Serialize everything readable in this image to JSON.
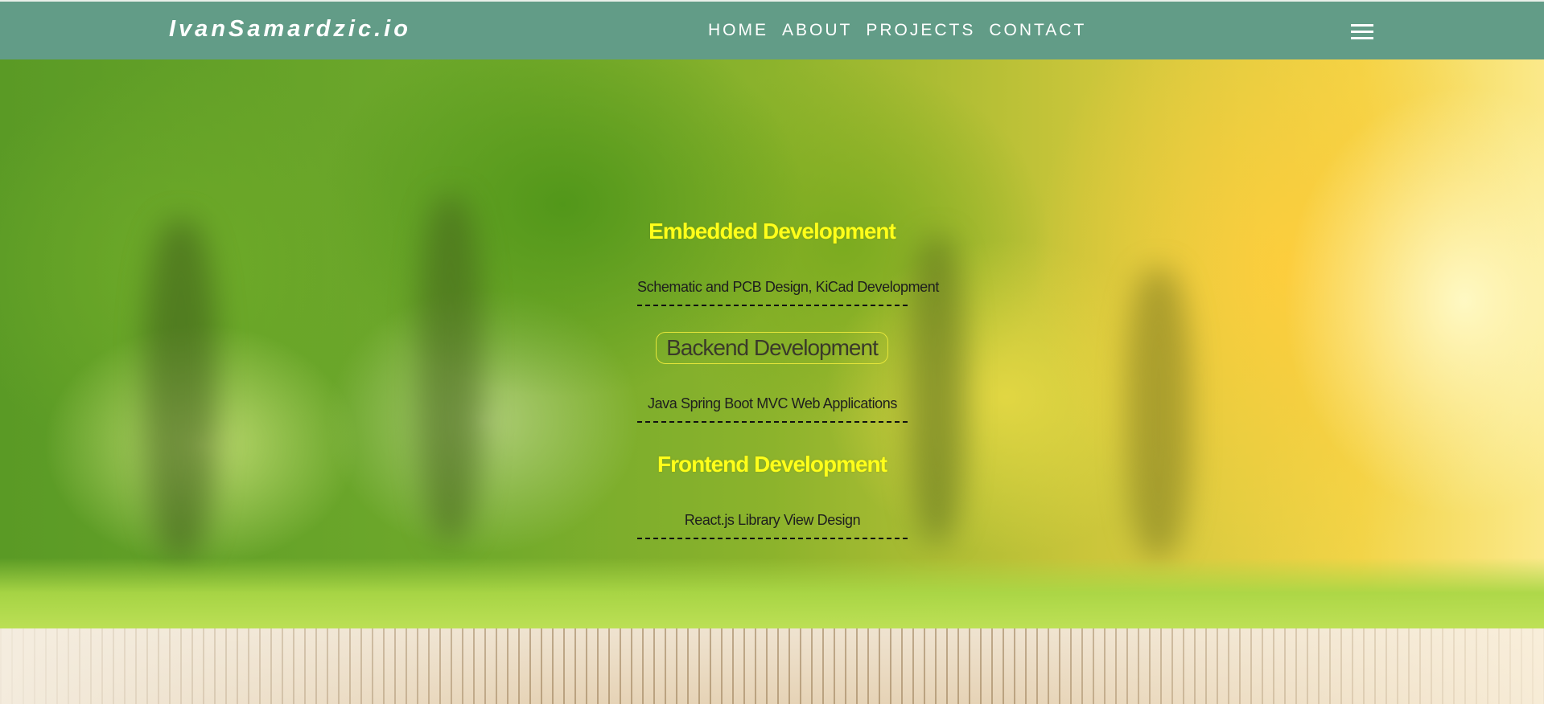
{
  "header": {
    "brand": "IvanSamardzic.io",
    "nav": [
      "HOME",
      "ABOUT",
      "PROJECTS",
      "CONTACT"
    ],
    "menu_icon": "hamburger-menu-icon",
    "colors": {
      "navbar": "#629c87",
      "nav_text": "#ffffff"
    }
  },
  "services": [
    {
      "title": "Embedded Development",
      "description": "Schematic and PCB Design, KiCad Development",
      "highlighted": false
    },
    {
      "title": "Backend Development",
      "description": "Java Spring Boot MVC Web Applications",
      "highlighted": true
    },
    {
      "title": "Frontend Development",
      "description": "React.js Library View Design",
      "highlighted": false
    }
  ],
  "colors": {
    "title_yellow": "#ffff1a",
    "description_text": "#1e1e1e"
  }
}
